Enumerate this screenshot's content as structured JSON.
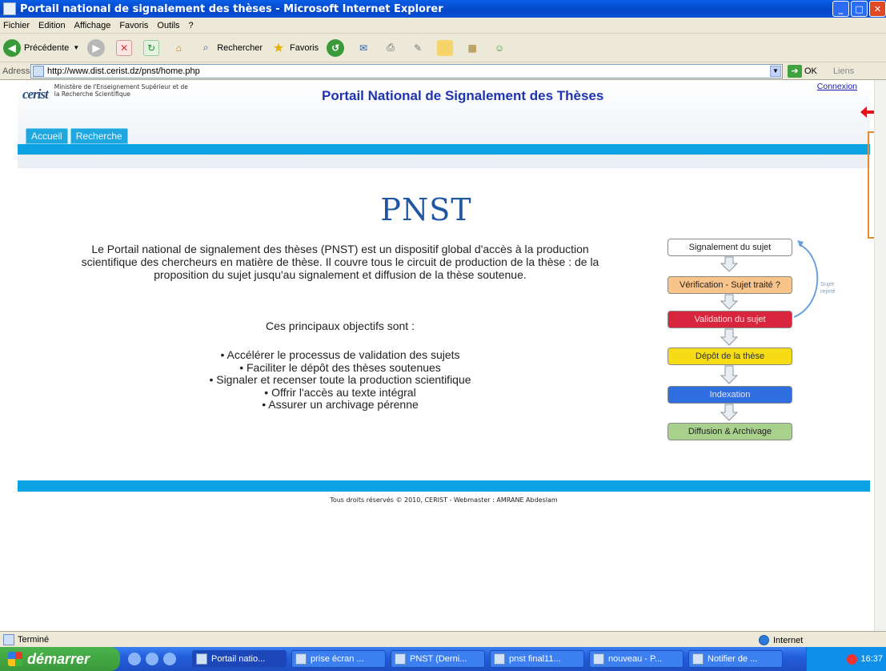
{
  "window": {
    "title": "Portail national de signalement des thèses - Microsoft Internet Explorer"
  },
  "menu": [
    "Fichier",
    "Edition",
    "Affichage",
    "Favoris",
    "Outils",
    "?"
  ],
  "toolbar": {
    "back": "Précédente",
    "search": "Rechercher",
    "favorites": "Favoris"
  },
  "address": {
    "label": "Adresse",
    "url": "http://www.dist.cerist.dz/pnst/home.php",
    "go": "OK",
    "links": "Liens"
  },
  "header": {
    "logo": "cerist",
    "ministry": "Ministère de l'Enseignement Supérieur et de la Recherche Scientifique",
    "title": "Portail National de Signalement des Thèses",
    "connexion": "Connexion",
    "tabs": [
      "Accueil",
      "Recherche"
    ]
  },
  "content": {
    "heading": "PNST",
    "intro": "Le Portail national de signalement des thèses (PNST) est un dispositif global d'accès à la production scientifique des chercheurs en matière de thèse. Il couvre tous le circuit de production de la thèse : de la proposition du sujet jusqu'au signalement et diffusion de la thèse soutenue.",
    "objectives_intro": "Ces principaux objectifs sont :",
    "objectives": [
      "Accélérer le processus de validation des sujets",
      "Faciliter le dépôt des thèses soutenues",
      "Signaler et recenser toute la production scientifique",
      "Offrir l'accès au texte intégral",
      "Assurer un archivage pérenne"
    ]
  },
  "flow": {
    "steps": [
      {
        "label": "Signalement du sujet",
        "color": "#ffffff",
        "text": "#222222"
      },
      {
        "label": "Vérification - Sujet traité ?",
        "color": "#f9c48a",
        "text": "#222222"
      },
      {
        "label": "Validation du sujet",
        "color": "#d7263d",
        "text": "#ffdede"
      },
      {
        "label": "Dépôt de la thèse",
        "color": "#f5dc16",
        "text": "#333333"
      },
      {
        "label": "Indexation",
        "color": "#2e6ee0",
        "text": "#dde8ff"
      },
      {
        "label": "Diffusion & Archivage",
        "color": "#a9d18e",
        "text": "#222222"
      }
    ],
    "rejected": "Sujet rejeté"
  },
  "footer": "Tous droits réservés © 2010, CERIST - Webmaster : AMRANE Abdeslam",
  "status": {
    "text": "Terminé",
    "zone": "Internet"
  },
  "taskbar": {
    "start": "démarrer",
    "tasks": [
      "Portail natio...",
      "prise écran ...",
      "PNST (Derni...",
      "pnst final11...",
      "nouveau - P...",
      "Notifier de ..."
    ],
    "clock": "16:37"
  }
}
